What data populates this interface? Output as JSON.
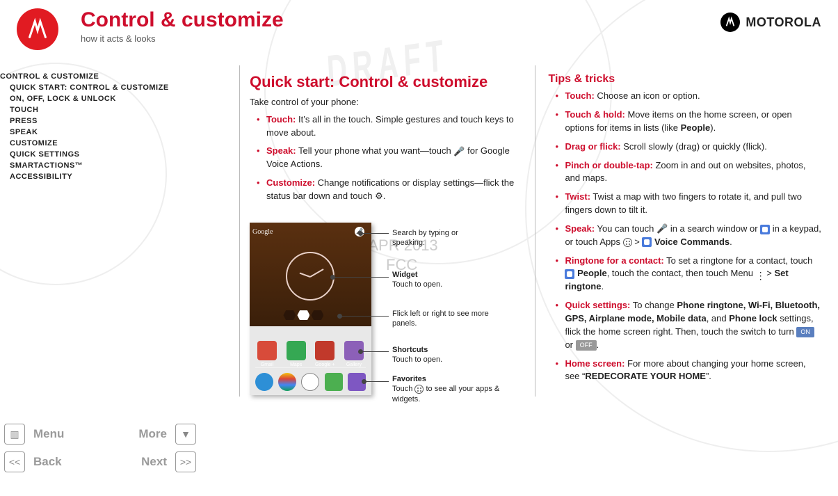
{
  "header": {
    "title": "Control & customize",
    "subtitle": "how it acts & looks",
    "brand": "MOTOROLA"
  },
  "watermark": {
    "draft": "DRAFT",
    "date": "16 APR 2013",
    "fcc": "FCC"
  },
  "toc": [
    {
      "label": "CONTROL & CUSTOMIZE",
      "level": 0
    },
    {
      "label": "QUICK START: CONTROL & CUSTOMIZE",
      "level": 1
    },
    {
      "label": "ON, OFF, LOCK & UNLOCK",
      "level": 1
    },
    {
      "label": "TOUCH",
      "level": 1
    },
    {
      "label": "PRESS",
      "level": 1
    },
    {
      "label": "SPEAK",
      "level": 1
    },
    {
      "label": "CUSTOMIZE",
      "level": 1
    },
    {
      "label": "QUICK SETTINGS",
      "level": 1
    },
    {
      "label": "SMARTACTIONS™",
      "level": 1
    },
    {
      "label": "ACCESSIBILITY",
      "level": 1
    }
  ],
  "mid": {
    "heading": "Quick start: Control & customize",
    "lead": "Take control of your phone:",
    "items": [
      {
        "kw": "Touch:",
        "text": " It’s all in the touch. Simple gestures and touch keys to move about."
      },
      {
        "kw": "Speak:",
        "text_a": " Tell your phone what you want—touch ",
        "text_b": " for Google Voice Actions."
      },
      {
        "kw": "Customize:",
        "text_a": " Change notifications or display settings—flick the status bar down and touch ",
        "text_b": "."
      }
    ]
  },
  "phone": {
    "search_logo": "Google",
    "apps": [
      {
        "label": "Gmail",
        "color": "#d84b3a"
      },
      {
        "label": "Maps",
        "color": "#35a853"
      },
      {
        "label": "Google +",
        "color": "#c1392b"
      },
      {
        "label": "Gallery",
        "color": "#8c60b8"
      }
    ],
    "callouts": {
      "search": "Search by typing or speaking.",
      "widget_t": "Widget",
      "widget_b": "Touch to open.",
      "flick": "Flick left or right to see more panels.",
      "short_t": "Shortcuts",
      "short_b": "Touch to open.",
      "fav_t": "Favorites",
      "fav_b_a": "Touch ",
      "fav_b_b": " to see all your apps & widgets."
    }
  },
  "tips": {
    "heading": "Tips & tricks",
    "items": {
      "touch": {
        "kw": "Touch:",
        "text": " Choose an icon or option."
      },
      "hold": {
        "kw": "Touch & hold:",
        "a": " Move items on the home screen, or open options for items in lists (like ",
        "b": "People",
        "c": ")."
      },
      "drag": {
        "kw": "Drag or flick:",
        "text": " Scroll slowly (drag) or quickly (flick)."
      },
      "pinch": {
        "kw": "Pinch or double-tap:",
        "text": " Zoom in and out on websites, photos, and maps."
      },
      "twist": {
        "kw": "Twist:",
        "text": " Twist a map with two fingers to rotate it, and pull two fingers down to tilt it."
      },
      "speak": {
        "kw": "Speak:",
        "a": " You can touch ",
        "b": " in a search window or ",
        "c": " in a keypad, or touch Apps ",
        "d": " > ",
        "e": "Voice Commands",
        "f": "."
      },
      "ring": {
        "kw": "Ringtone for a contact:",
        "a": " To set a ringtone for a contact, touch ",
        "b": "People",
        "c": ", touch the contact, then touch Menu ",
        "d": " > ",
        "e": "Set ringtone",
        "f": "."
      },
      "qset": {
        "kw": "Quick settings:",
        "a": " To change ",
        "list": "Phone ringtone, Wi‑Fi, Bluetooth, GPS, Airplane mode, Mobile data",
        "b": ", and ",
        "c": "Phone lock",
        "d": " settings, flick the home screen right. Then, touch the switch to turn ",
        "on": "ON",
        "e": " or ",
        "off": "OFF",
        "f": "."
      },
      "home": {
        "kw": "Home screen:",
        "a": " For more about changing your home screen, see “",
        "b": "REDECORATE YOUR HOME",
        "c": "”."
      }
    }
  },
  "nav": {
    "menu": "Menu",
    "more": "More",
    "back": "Back",
    "next": "Next"
  }
}
